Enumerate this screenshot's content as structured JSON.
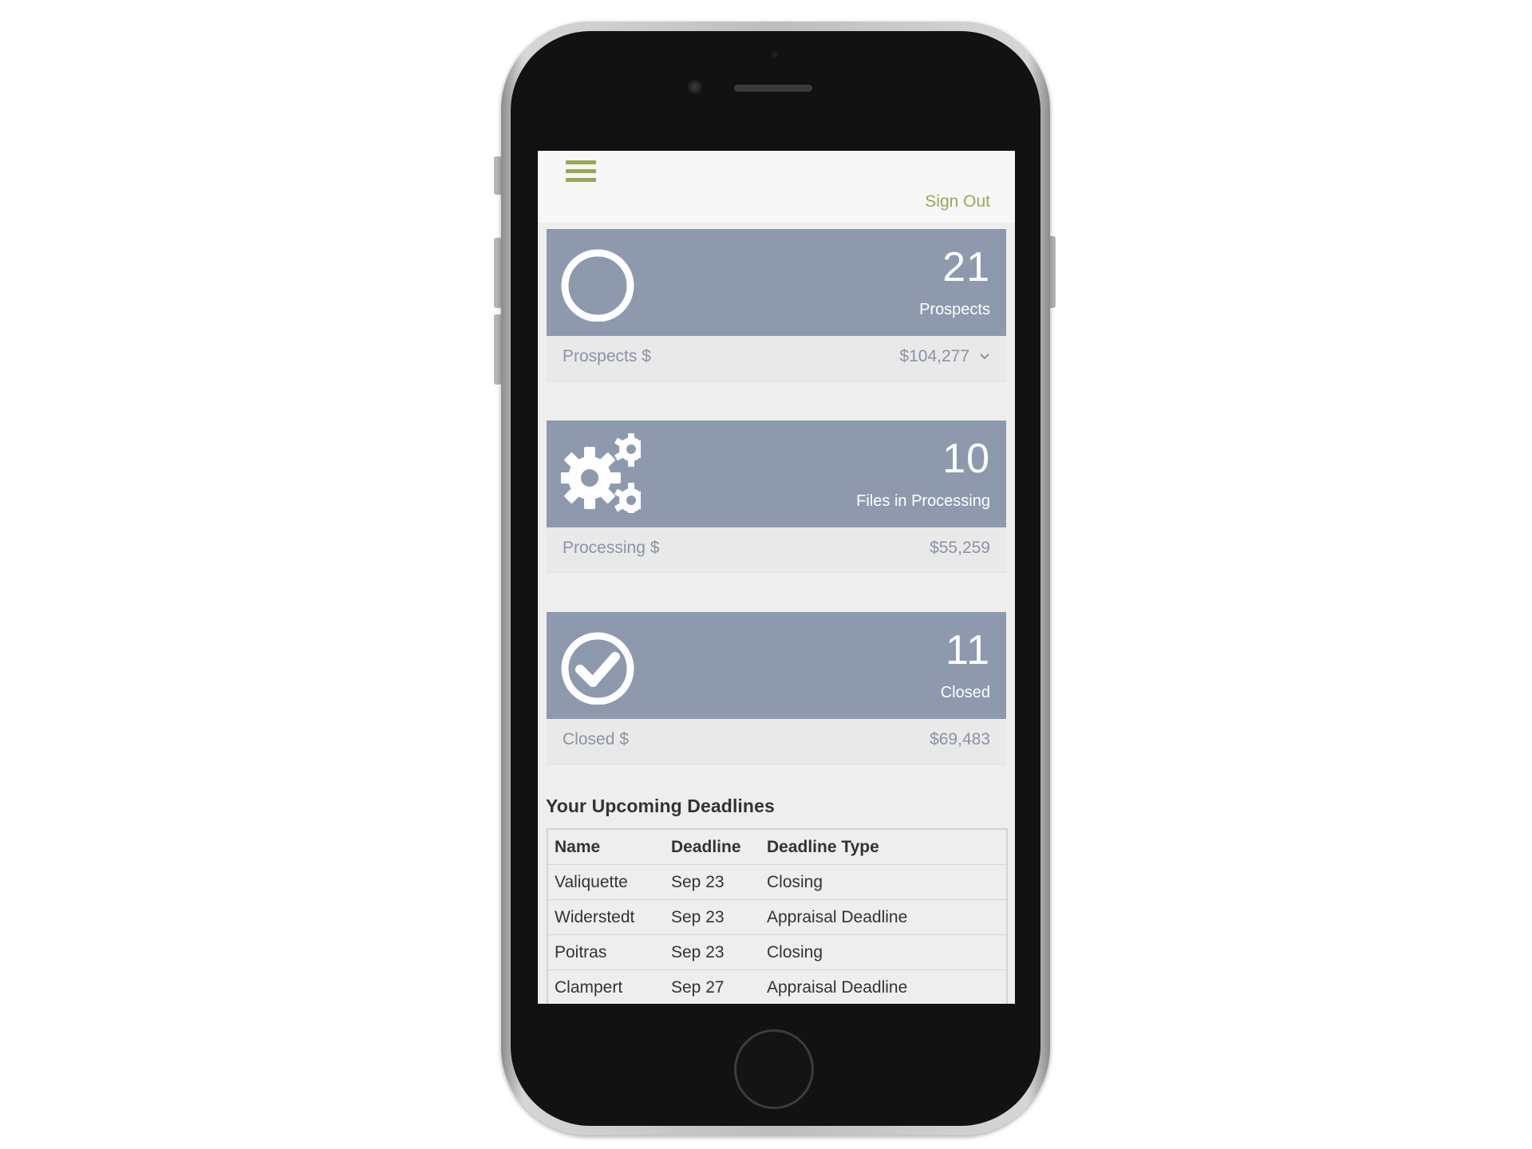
{
  "header": {
    "menu_icon": "hamburger-menu-icon",
    "sign_out_label": "Sign Out",
    "accent_color": "#9aa856"
  },
  "cards": [
    {
      "icon": "circle-outline-icon",
      "count": "21",
      "label": "Prospects",
      "footer_label": "Prospects $",
      "footer_value": "$104,277",
      "expandable": true
    },
    {
      "icon": "gears-icon",
      "count": "10",
      "label": "Files in Processing",
      "footer_label": "Processing $",
      "footer_value": "$55,259",
      "expandable": false
    },
    {
      "icon": "check-circle-icon",
      "count": "11",
      "label": "Closed",
      "footer_label": "Closed $",
      "footer_value": "$69,483",
      "expandable": false
    }
  ],
  "deadlines": {
    "title": "Your Upcoming Deadlines",
    "columns": [
      "Name",
      "Deadline",
      "Deadline Type"
    ],
    "rows": [
      [
        "Valiquette",
        "Sep 23",
        "Closing"
      ],
      [
        "Widerstedt",
        "Sep 23",
        "Appraisal Deadline"
      ],
      [
        "Poitras",
        "Sep 23",
        "Closing"
      ],
      [
        "Clampert",
        "Sep 27",
        "Appraisal Deadline"
      ]
    ]
  },
  "colors": {
    "card_header": "#8e99ae",
    "card_footer_text": "#8b93a3",
    "screen_bg": "#eeeeee"
  }
}
